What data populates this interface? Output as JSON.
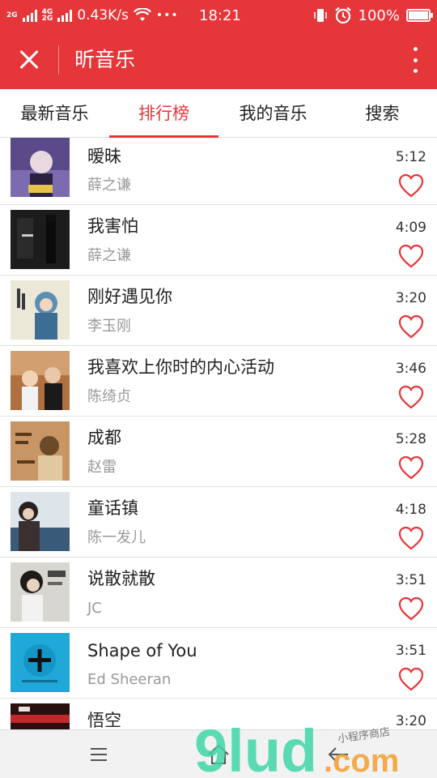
{
  "status_bar": {
    "net_top": "2G",
    "net_mid": "4G",
    "net_bot": "2G",
    "speed": "0.43K/s",
    "dots": "•••",
    "time": "18:21",
    "battery_text": "100%",
    "battery_level": 1.0
  },
  "header": {
    "title": "昕音乐"
  },
  "tabs": [
    {
      "label": "最新音乐",
      "active": false
    },
    {
      "label": "排行榜",
      "active": true
    },
    {
      "label": "我的音乐",
      "active": false
    },
    {
      "label": "搜索",
      "active": false
    }
  ],
  "songs": [
    {
      "title": "暧昧",
      "artist": "薛之谦",
      "duration": "5:12"
    },
    {
      "title": "我害怕",
      "artist": "薛之谦",
      "duration": "4:09"
    },
    {
      "title": "刚好遇见你",
      "artist": "李玉刚",
      "duration": "3:20"
    },
    {
      "title": "我喜欢上你时的内心活动",
      "artist": "陈绮贞",
      "duration": "3:46"
    },
    {
      "title": "成都",
      "artist": "赵雷",
      "duration": "5:28"
    },
    {
      "title": "童话镇",
      "artist": "陈一发儿",
      "duration": "4:18"
    },
    {
      "title": "说散就散",
      "artist": "JC",
      "duration": "3:51"
    },
    {
      "title": "Shape of You",
      "artist": "Ed Sheeran",
      "duration": "3:51"
    },
    {
      "title": "悟空",
      "artist": "",
      "duration": "3:20"
    }
  ],
  "watermark": {
    "brand": "9lud",
    "suffix": ".com",
    "tagline": "小程序商店"
  },
  "colors": {
    "accent": "#e5363a",
    "heart": "#e5363a"
  }
}
